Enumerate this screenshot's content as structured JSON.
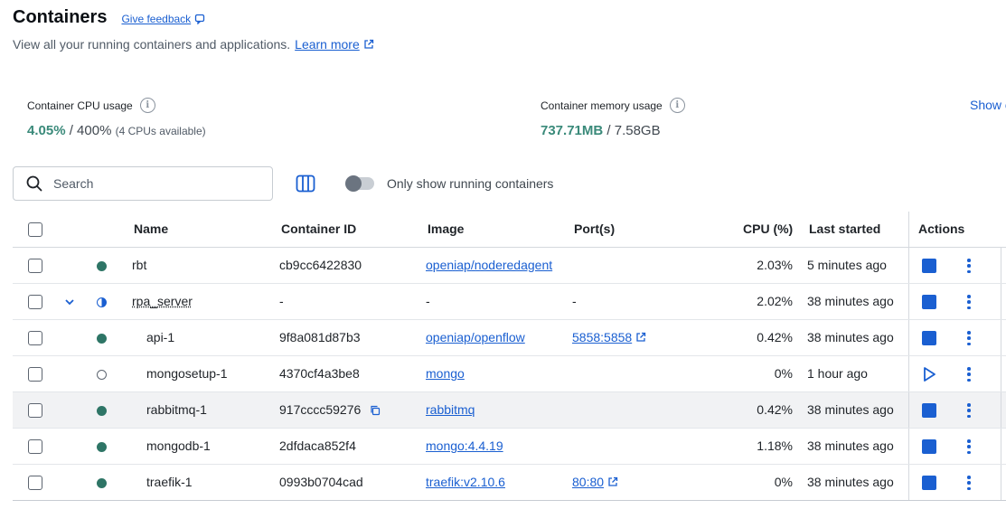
{
  "header": {
    "title": "Containers",
    "feedback_label": "Give feedback",
    "subtitle": "View all your running containers and applications.",
    "learn_more": "Learn more"
  },
  "stats": {
    "cpu_label": "Container CPU usage",
    "cpu_used": "4.05%",
    "cpu_total": "/ 400%",
    "cpu_note": "(4 CPUs available)",
    "mem_label": "Container memory usage",
    "mem_used": "737.71MB",
    "mem_total": "/ 7.58GB",
    "show_link": "Show c"
  },
  "toolbar": {
    "search_placeholder": "Search",
    "toggle_label": "Only show running containers",
    "toggle_on": false
  },
  "table": {
    "headers": {
      "name": "Name",
      "container_id": "Container ID",
      "image": "Image",
      "ports": "Port(s)",
      "cpu": "CPU (%)",
      "last_started": "Last started",
      "actions": "Actions"
    },
    "rows": [
      {
        "name": "rbt",
        "id": "cb9cc6422830",
        "image": "openiap/noderedagent",
        "ports": "",
        "cpu": "2.03%",
        "last_started": "5 minutes ago",
        "status": "running",
        "action": "stop"
      },
      {
        "name": "rpa_server",
        "id": "-",
        "image": "-",
        "ports": "-",
        "cpu": "2.02%",
        "last_started": "38 minutes ago",
        "status": "partial",
        "action": "stop"
      },
      {
        "name": "api-1",
        "id": "9f8a081d87b3",
        "image": "openiap/openflow",
        "ports": "5858:5858",
        "cpu": "0.42%",
        "last_started": "38 minutes ago",
        "status": "running",
        "action": "stop"
      },
      {
        "name": "mongosetup-1",
        "id": "4370cf4a3be8",
        "image": "mongo",
        "ports": "",
        "cpu": "0%",
        "last_started": "1 hour ago",
        "status": "stopped",
        "action": "start"
      },
      {
        "name": "rabbitmq-1",
        "id": "917cccc59276",
        "image": "rabbitmq",
        "ports": "",
        "cpu": "0.42%",
        "last_started": "38 minutes ago",
        "status": "running",
        "action": "stop"
      },
      {
        "name": "mongodb-1",
        "id": "2dfdaca852f4",
        "image": "mongo:4.4.19",
        "ports": "",
        "cpu": "1.18%",
        "last_started": "38 minutes ago",
        "status": "running",
        "action": "stop"
      },
      {
        "name": "traefik-1",
        "id": "0993b0704cad",
        "image": "traefik:v2.10.6",
        "ports": "80:80",
        "cpu": "0%",
        "last_started": "38 minutes ago",
        "status": "running",
        "action": "stop"
      }
    ]
  },
  "colors": {
    "accent": "#1a5fd1",
    "running": "#2e7566",
    "stat_highlight": "#3a8a7a"
  }
}
